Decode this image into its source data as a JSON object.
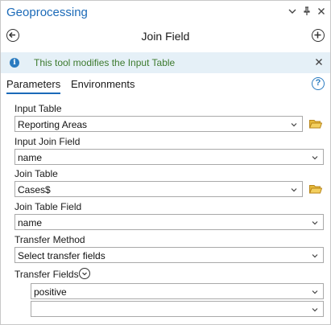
{
  "pane": {
    "title": "Geoprocessing",
    "menu_icon": "chevron-down-icon",
    "pin_icon": "pin-icon",
    "close_icon": "close-icon"
  },
  "header": {
    "tool_title": "Join Field",
    "back_icon": "back-arrow-icon",
    "add_icon": "add-icon"
  },
  "info": {
    "message": "This tool modifies the Input Table",
    "icon": "info-icon",
    "close_icon": "close-icon"
  },
  "tabs": [
    {
      "label": "Parameters",
      "active": true
    },
    {
      "label": "Environments",
      "active": false
    }
  ],
  "help_icon": "help-icon",
  "form": {
    "input_table": {
      "label": "Input Table",
      "value": "Reporting Areas"
    },
    "input_join_field": {
      "label": "Input Join Field",
      "value": "name"
    },
    "join_table": {
      "label": "Join Table",
      "value": "Cases$"
    },
    "join_table_field": {
      "label": "Join Table Field",
      "value": "name"
    },
    "transfer_method": {
      "label": "Transfer Method",
      "value": "Select transfer fields"
    },
    "transfer_fields": {
      "label": "Transfer Fields",
      "values": [
        "positive",
        ""
      ]
    }
  },
  "colors": {
    "accent": "#1b6ab8",
    "info_bg": "#e5f0f7",
    "info_text": "#3d7a2e",
    "folder": "#d9a520"
  }
}
